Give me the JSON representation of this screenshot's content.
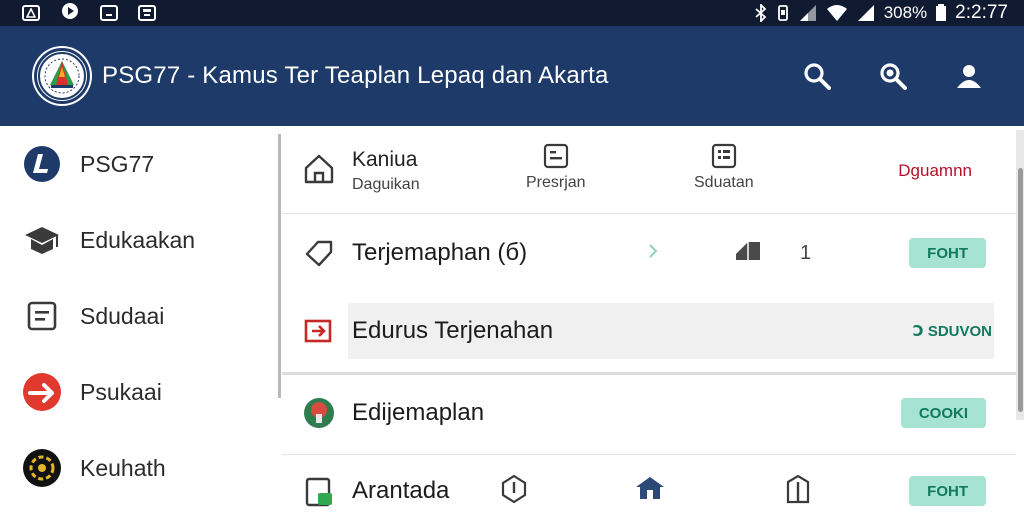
{
  "status_bar": {
    "battery": "308%",
    "time": "2:2:77"
  },
  "app_bar": {
    "title": "PSG77 - Kamus Ter Teaplan Lepaq dan Akarta"
  },
  "sidebar": {
    "items": [
      {
        "label": "PSG77",
        "icon": "brand-icon"
      },
      {
        "label": "Edukaakan",
        "icon": "graduation-cap-icon"
      },
      {
        "label": "Sdudaai",
        "icon": "document-icon"
      },
      {
        "label": "Psukaai",
        "icon": "plane-icon"
      },
      {
        "label": "Keuhath",
        "icon": "emblem-icon"
      }
    ]
  },
  "main": {
    "category_row": {
      "home": {
        "title": "Kaniua",
        "subtitle": "Daguikan"
      },
      "items": [
        {
          "label": "Presrjan"
        },
        {
          "label": "Sduatan"
        }
      ],
      "link": "Dguamnn"
    },
    "rows": [
      {
        "title": "Terjemaphan (б)",
        "count": "1",
        "badge": "FOHT"
      },
      {
        "title": "Edurus Terjenahan",
        "link": "Ↄ SDUVON"
      },
      {
        "title": "Edijemaplan",
        "badge": "COOKI"
      },
      {
        "title": "Arantada",
        "badge": "FOHT"
      }
    ]
  },
  "colors": {
    "app_bar": "#1d3a69",
    "status_bar": "#101a30",
    "badge_bg": "#a7e3d2",
    "badge_text": "#117a5c",
    "red_link": "#b3122a"
  }
}
